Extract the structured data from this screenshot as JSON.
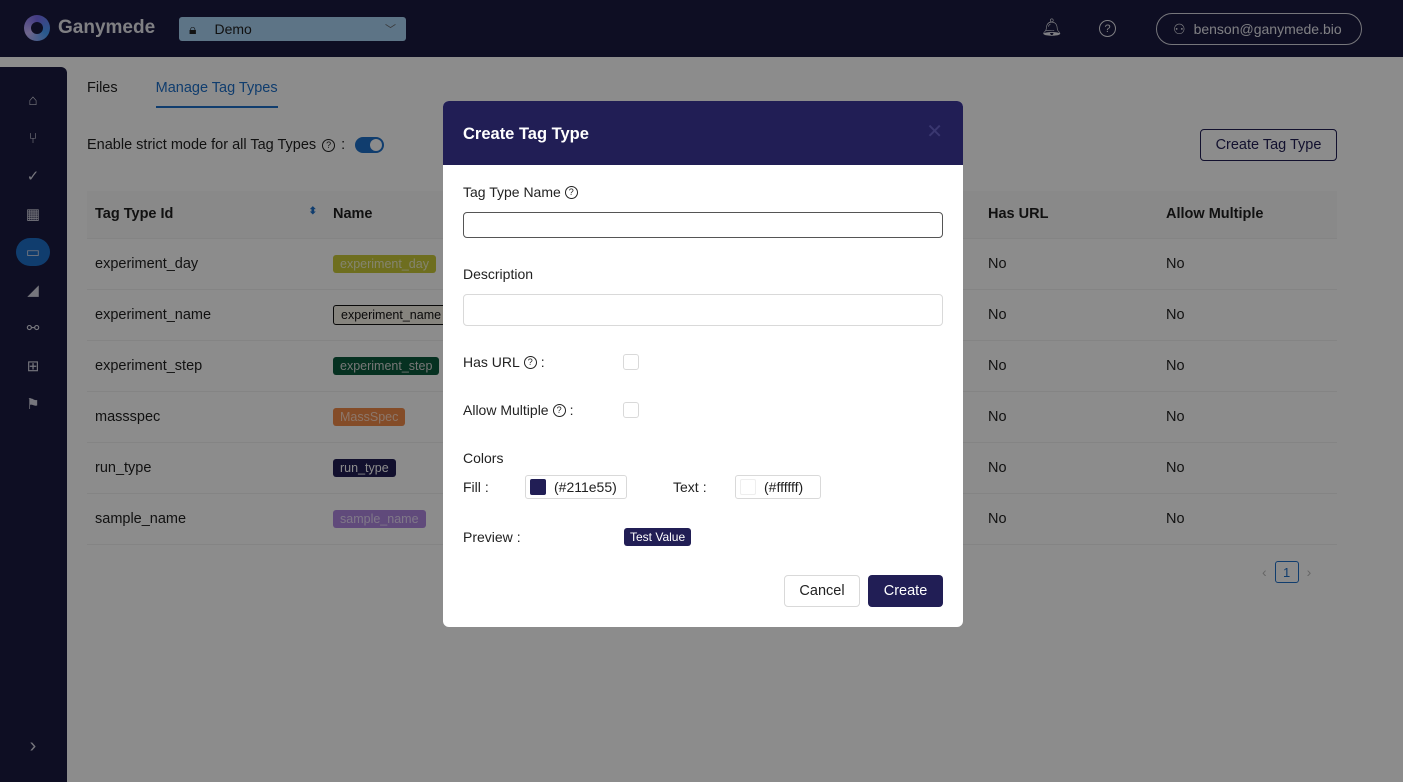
{
  "app": {
    "name": "Ganymede",
    "environment": "Demo",
    "user": "benson@ganymede.bio"
  },
  "tabs": [
    {
      "label": "Files",
      "active": false
    },
    {
      "label": "Manage Tag Types",
      "active": true
    }
  ],
  "strict_mode": {
    "label": "Enable strict mode for all Tag Types",
    "colon": ":",
    "enabled": true
  },
  "create_button": "Create Tag Type",
  "table": {
    "headers": [
      "Tag Type Id",
      "Name",
      "Has URL",
      "Allow Multiple"
    ],
    "rows": [
      {
        "id": "experiment_day",
        "name": "experiment_day",
        "fill": "#c8c83a",
        "text": "#f0f0c8",
        "has_url": "No",
        "allow_multiple": "No"
      },
      {
        "id": "experiment_name",
        "name": "experiment_name",
        "fill": "#f4f0e6",
        "text": "#111111",
        "has_url": "No",
        "allow_multiple": "No"
      },
      {
        "id": "experiment_step",
        "name": "experiment_step",
        "fill": "#0c5a3c",
        "text": "#d8d8d8",
        "has_url": "No",
        "allow_multiple": "No"
      },
      {
        "id": "massspec",
        "name": "MassSpec",
        "fill": "#f08a4a",
        "text": "#ffd8c0",
        "has_url": "No",
        "allow_multiple": "No"
      },
      {
        "id": "run_type",
        "name": "run_type",
        "fill": "#211e55",
        "text": "#ffffff",
        "has_url": "No",
        "allow_multiple": "No"
      },
      {
        "id": "sample_name",
        "name": "sample_name",
        "fill": "#b088e0",
        "text": "#e8daf8",
        "has_url": "No",
        "allow_multiple": "No"
      }
    ]
  },
  "pagination": {
    "current": "1"
  },
  "modal": {
    "title": "Create Tag Type",
    "name_label": "Tag Type Name",
    "name_value": "",
    "description_label": "Description",
    "description_value": "",
    "has_url_label": "Has URL",
    "has_url": false,
    "allow_multiple_label": "Allow Multiple",
    "allow_multiple": false,
    "colors_label": "Colors",
    "fill_label": "Fill",
    "fill_value": "(#211e55)",
    "fill_color": "#211e55",
    "text_label": "Text",
    "text_value": "(#ffffff)",
    "text_color": "#ffffff",
    "preview_label": "Preview",
    "preview_value": "Test Value",
    "cancel": "Cancel",
    "create": "Create"
  },
  "colon": ":"
}
